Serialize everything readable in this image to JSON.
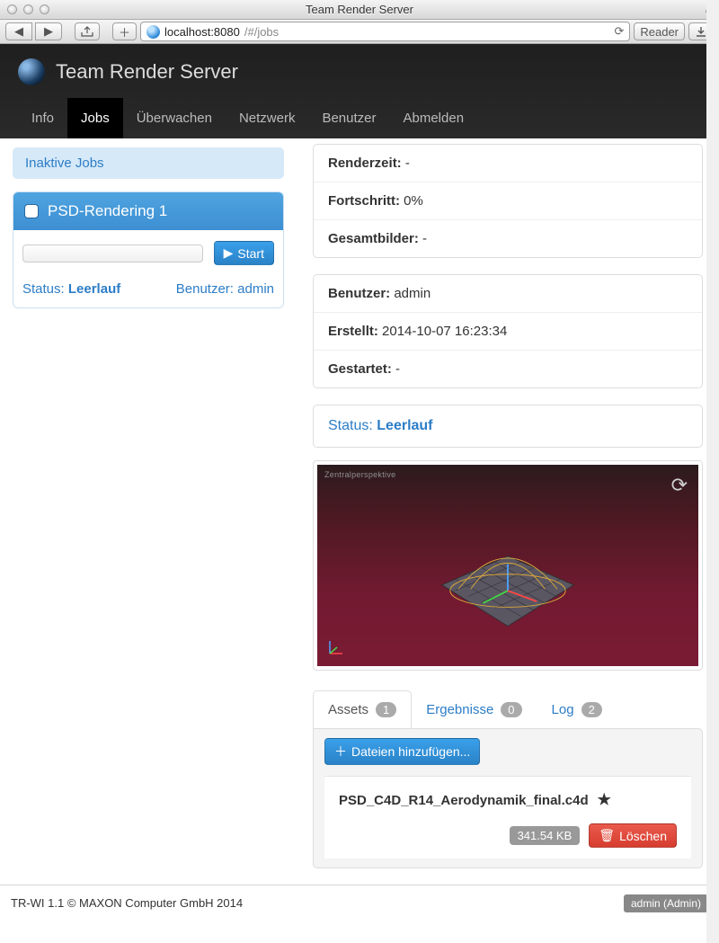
{
  "window": {
    "title": "Team Render Server",
    "url_host": "localhost:8080",
    "url_path": "/#/jobs",
    "reader_label": "Reader"
  },
  "brand": {
    "title": "Team Render Server"
  },
  "nav": {
    "info": "Info",
    "jobs": "Jobs",
    "monitor": "Überwachen",
    "network": "Netzwerk",
    "users": "Benutzer",
    "logout": "Abmelden"
  },
  "sidebar": {
    "inactive_header": "Inaktive Jobs",
    "job": {
      "title": "PSD-Rendering 1",
      "start_label": "Start",
      "status_label": "Status:",
      "status_value": "Leerlauf",
      "user_label": "Benutzer:",
      "user_value": "admin"
    }
  },
  "details": {
    "rows1": [
      {
        "label": "Renderzeit:",
        "value": " -"
      },
      {
        "label": "Fortschritt:",
        "value": " 0%"
      },
      {
        "label": "Gesamtbilder:",
        "value": " -"
      }
    ],
    "rows2": [
      {
        "label": "Benutzer:",
        "value": " admin"
      },
      {
        "label": "Erstellt:",
        "value": " 2014-10-07 16:23:34"
      },
      {
        "label": "Gestartet:",
        "value": " -"
      }
    ],
    "status_label": "Status:",
    "status_value": "Leerlauf",
    "preview_corner": "Zentralperspektive"
  },
  "subtabs": {
    "assets": {
      "label": "Assets",
      "count": "1"
    },
    "results": {
      "label": "Ergebnisse",
      "count": "0"
    },
    "log": {
      "label": "Log",
      "count": "2"
    },
    "add_files": "Dateien hinzufügen...",
    "asset_name": "PSD_C4D_R14_Aerodynamik_final.c4d",
    "asset_size": "341.54 KB",
    "delete_label": "Löschen"
  },
  "footer": {
    "left": "TR-WI 1.1 © MAXON Computer GmbH 2014",
    "right": "admin (Admin)"
  }
}
